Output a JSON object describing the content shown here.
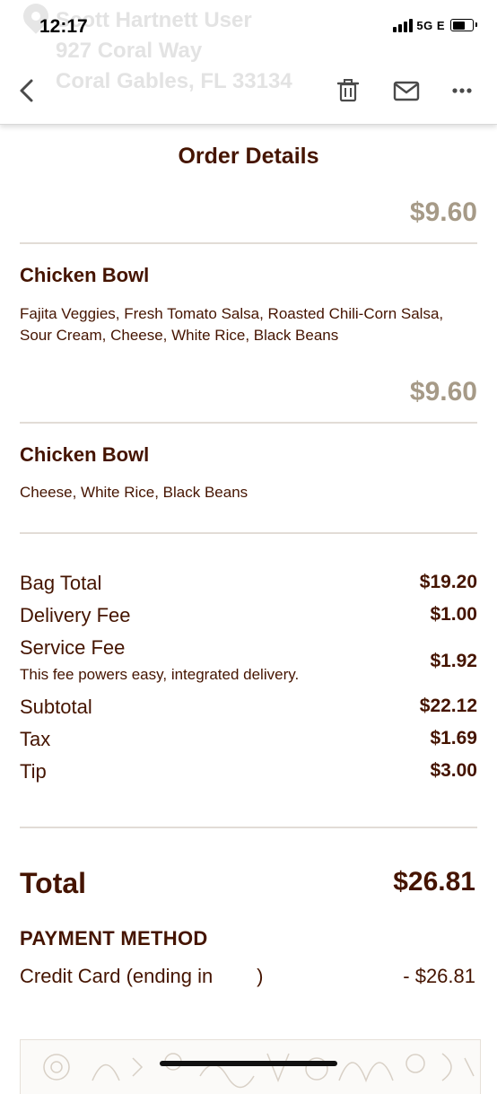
{
  "status_bar": {
    "time": "12:17",
    "network": "5G E"
  },
  "header": {
    "faded_lines": [
      "Scott Hartnett User",
      "927 Coral Way",
      "Coral Gables, FL 33134"
    ],
    "icons": [
      "back-chevron-icon",
      "trash-icon",
      "mail-icon",
      "more-icon"
    ]
  },
  "order": {
    "title": "Order Details",
    "items": [
      {
        "price": "$9.60",
        "name": "Chicken Bowl",
        "description": "Fajita Veggies, Fresh Tomato Salsa, Roasted Chili-Corn Salsa, Sour Cream, Cheese, White Rice, Black Beans"
      },
      {
        "price": "$9.60",
        "name": "Chicken Bowl",
        "description": "Cheese, White Rice, Black Beans"
      }
    ]
  },
  "summary": {
    "rows": [
      {
        "label": "Bag Total",
        "value": "$19.20"
      },
      {
        "label": "Delivery Fee",
        "value": "$1.00"
      },
      {
        "label": "Service Fee",
        "value": "$1.92"
      },
      {
        "label": "Subtotal",
        "value": "$22.12"
      },
      {
        "label": "Tax",
        "value": "$1.69"
      },
      {
        "label": "Tip",
        "value": "$3.00"
      }
    ],
    "service_fee_note": "This fee powers easy, integrated delivery."
  },
  "total": {
    "label": "Total",
    "value": "$26.81"
  },
  "payment": {
    "heading": "PAYMENT METHOD",
    "method": "Credit Card (ending in        )",
    "amount": "- $26.81"
  },
  "colors": {
    "brand_brown": "#451400",
    "price_tan": "#a69a87",
    "divider": "#e2dcd6"
  }
}
